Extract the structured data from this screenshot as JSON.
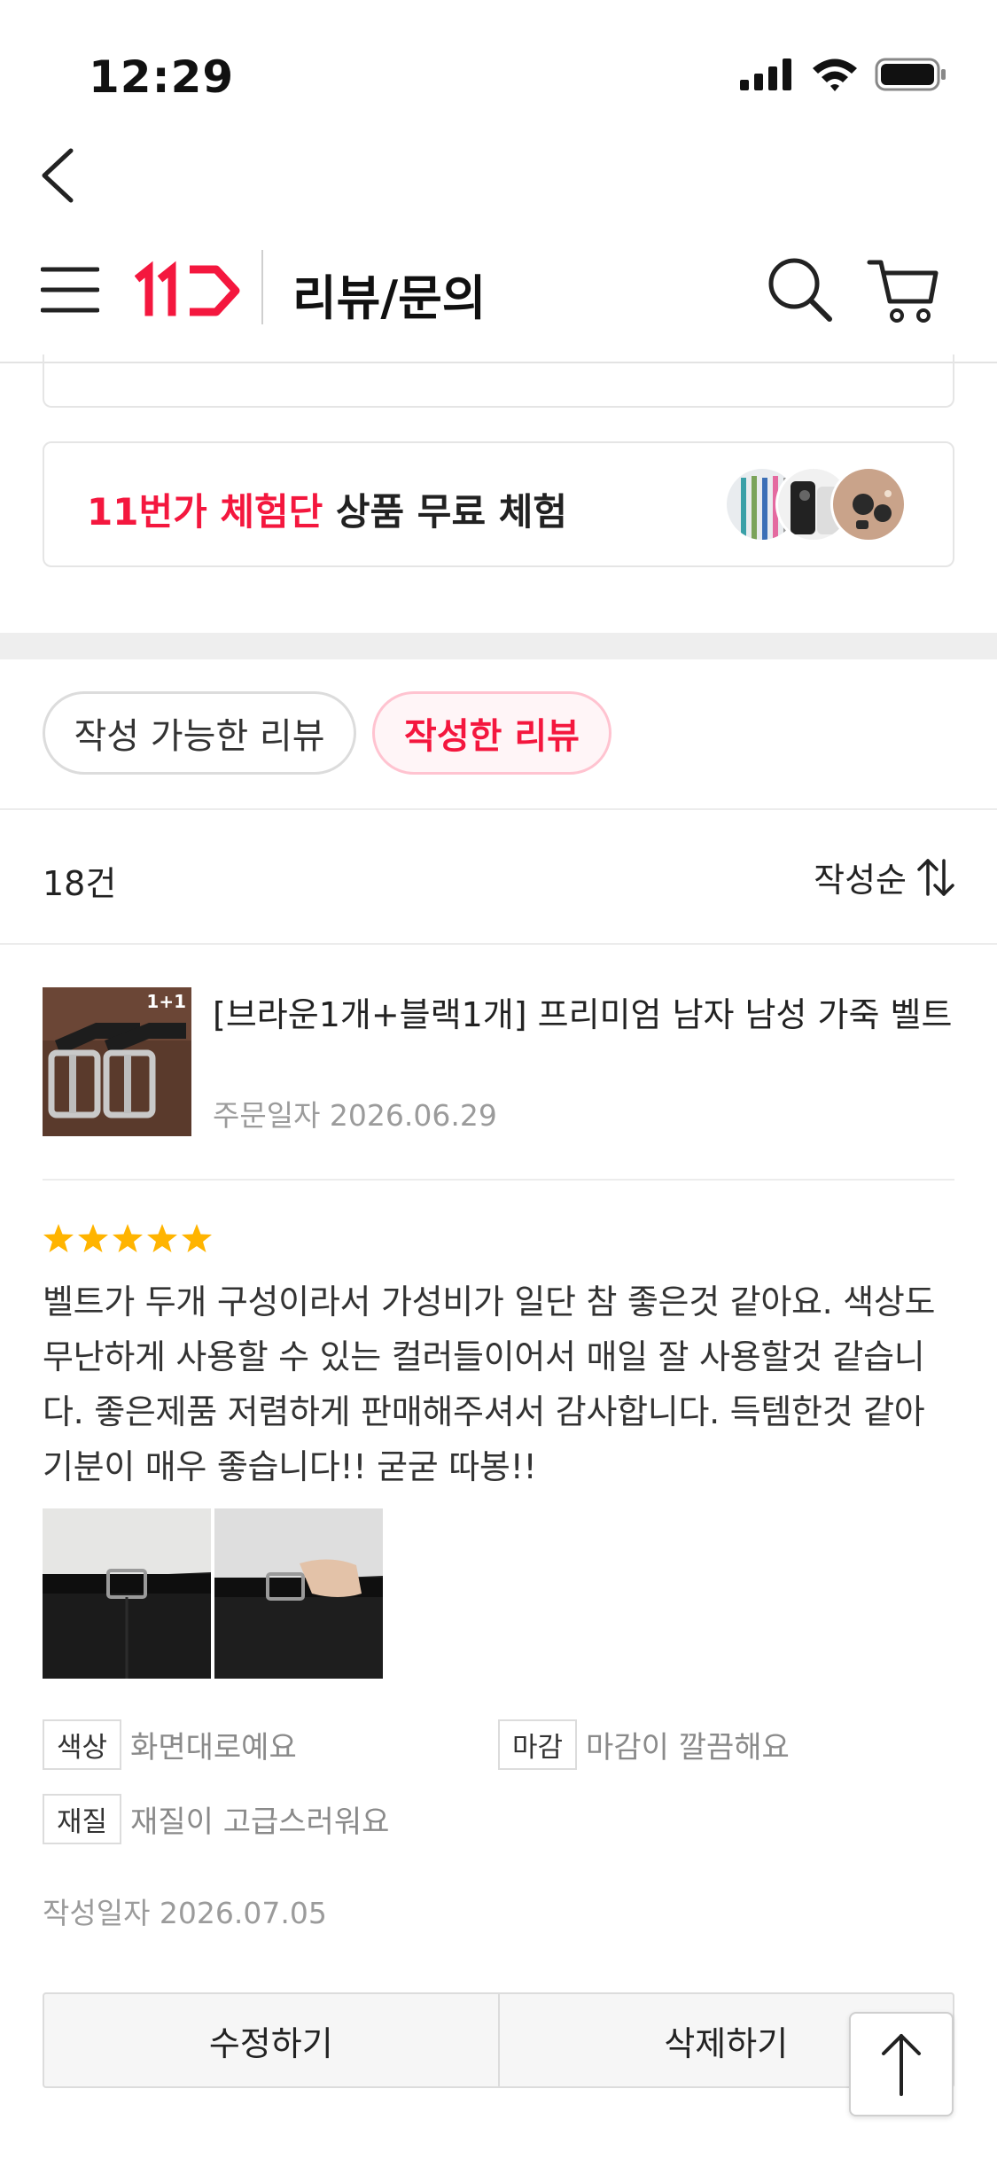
{
  "status": {
    "time": "12:29"
  },
  "nav": {
    "title": "리뷰/문의",
    "logo_text": "11"
  },
  "promo": {
    "brand": "11번가 체험단",
    "rest": " 상품 무료 체험"
  },
  "filters": {
    "available": "작성 가능한 리뷰",
    "written": "작성한 리뷰"
  },
  "list": {
    "count": "18건",
    "sort": "작성순"
  },
  "product": {
    "name": "[브라운1개+블랙1개] 프리미엄 남자 남성 가죽 벨트",
    "badge": "1+1",
    "order_date": "주문일자 2026.06.29"
  },
  "review": {
    "rating": 5,
    "text": "벨트가 두개 구성이라서 가성비가 일단 참 좋은것 같아요. 색상도 무난하게 사용할 수 있는 컬러들이어서 매일 잘 사용할것 같습니다. 좋은제품 저렴하게 판매해주셔서 감사합니다. 득템한것 같아 기분이 매우 좋습니다!! 굳굳 따봉!!",
    "attributes": [
      {
        "key": "색상",
        "value": "화면대로예요"
      },
      {
        "key": "마감",
        "value": "마감이 깔끔해요"
      },
      {
        "key": "재질",
        "value": "재질이 고급스러워요"
      }
    ],
    "written_date": "작성일자 2026.07.05"
  },
  "actions": {
    "edit": "수정하기",
    "delete": "삭제하기"
  },
  "colors": {
    "brand_red": "#f4173e",
    "star": "#ffb400"
  }
}
